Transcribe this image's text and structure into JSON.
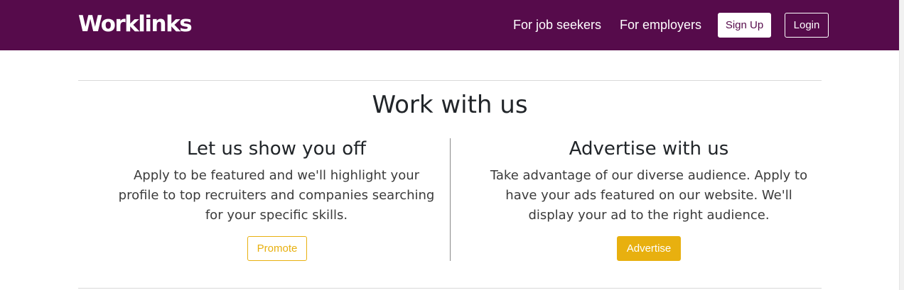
{
  "header": {
    "logo_text": "Worklinks",
    "nav_links": {
      "job_seekers": "For job seekers",
      "employers": "For employers"
    },
    "signup_label": "Sign Up",
    "login_label": "Login"
  },
  "main": {
    "title": "Work with us",
    "left": {
      "heading": "Let us show you off",
      "text": "Apply to be featured and we'll highlight your profile to top recruiters and companies searching for your specific skills.",
      "button_label": "Promote"
    },
    "right": {
      "heading": "Advertise with us",
      "text": "Take advantage of our diverse audience. Apply to have your ads featured on our website. We'll display your ad to the right audience.",
      "button_label": "Advertise"
    }
  },
  "colors": {
    "brand": "#560b4b",
    "accent": "#e8b00f",
    "text": "#212529"
  }
}
